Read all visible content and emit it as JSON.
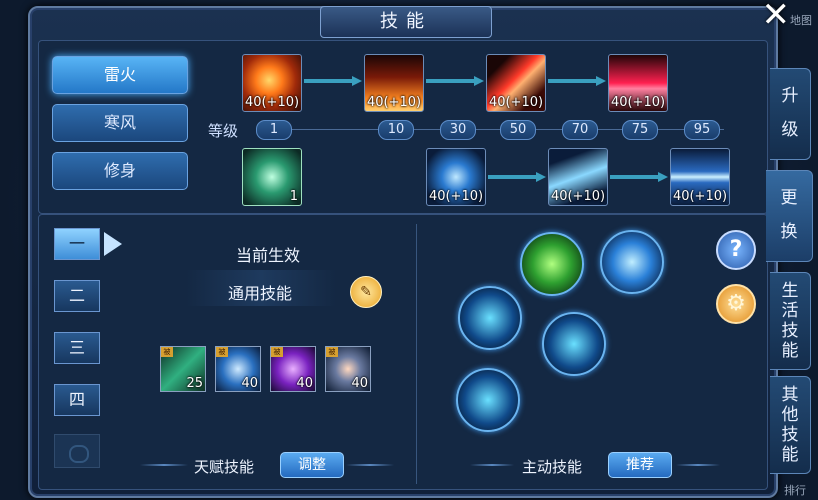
{
  "window": {
    "title": "技能",
    "close_icon": "close-icon"
  },
  "schools": [
    {
      "label": "雷火",
      "active": true
    },
    {
      "label": "寒风",
      "active": false
    },
    {
      "label": "修身",
      "active": false
    }
  ],
  "skill_tree": {
    "fire_row": [
      {
        "icon": "fire-burst-icon",
        "level": "40(+10)"
      },
      {
        "icon": "flame-wall-icon",
        "level": "40(+10)"
      },
      {
        "icon": "fire-slash-icon",
        "level": "40(+10)"
      },
      {
        "icon": "crimson-blaze-icon",
        "level": "40(+10)"
      }
    ],
    "level_label": "等级",
    "levels": [
      "1",
      "10",
      "30",
      "50",
      "70",
      "75",
      "95"
    ],
    "fist_skill": {
      "icon": "lightning-fist-icon",
      "level": "1"
    },
    "thunder_row": [
      {
        "icon": "lightning-bolt-icon",
        "level": "40(+10)"
      },
      {
        "icon": "lightning-strike-icon",
        "level": "40(+10)"
      },
      {
        "icon": "thunder-storm-icon",
        "level": "40(+10)"
      }
    ]
  },
  "loadout_tabs": [
    "一",
    "二",
    "三",
    "四"
  ],
  "talent_panel": {
    "current_label": "当前生效",
    "talent_name": "通用技能",
    "talents": [
      {
        "icon": "green-claw-icon",
        "level": "25"
      },
      {
        "icon": "ice-crystal-icon",
        "level": "40"
      },
      {
        "icon": "purple-burst-icon",
        "level": "40"
      },
      {
        "icon": "shield-gem-icon",
        "level": "40"
      }
    ],
    "section_label": "天赋技能",
    "adjust_label": "调整"
  },
  "active_panel": {
    "section_label": "主动技能",
    "recommend_label": "推荐"
  },
  "side_tabs": [
    {
      "label": "升级",
      "active": false
    },
    {
      "label": "更换",
      "active": true
    },
    {
      "label": "生活技能",
      "active": false
    },
    {
      "label": "其他技能",
      "active": false
    }
  ],
  "background_fragments": {
    "top_right": "地图",
    "bottom_right": "排行"
  },
  "colors": {
    "accent": "#4ab0ff",
    "gold": "#e8a020",
    "panel": "#142843"
  }
}
